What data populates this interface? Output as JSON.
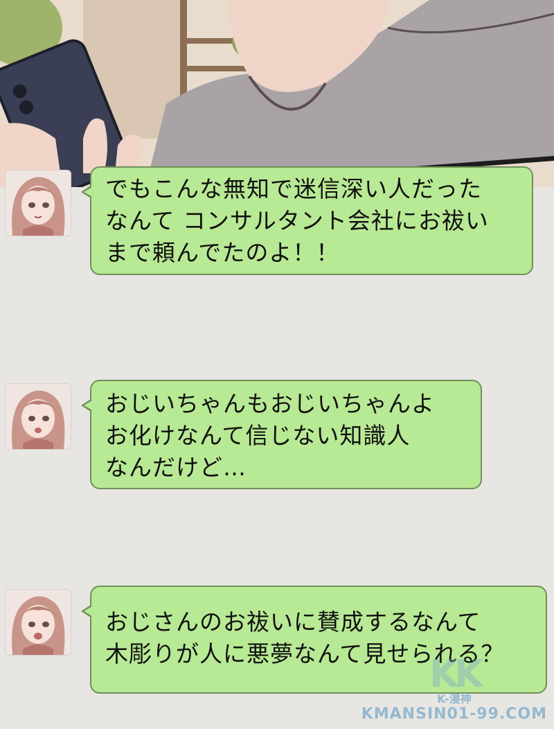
{
  "messages": [
    {
      "sender": "avatar-girl",
      "text": "でもこんな無知で迷信深い人だった\nなんて コンサルタント会社にお祓い\nまで頼んでたのよ！！"
    },
    {
      "sender": "avatar-girl",
      "text": "おじいちゃんもおじいちゃんよ\nお化けなんて信じない知識人\nなんだけど…"
    },
    {
      "sender": "avatar-girl",
      "text": "おじさんのお祓いに賛成するなんて\n木彫りが人に悪夢なんて見せられる？"
    }
  ],
  "watermark": {
    "logo": "KK",
    "brand": "K-漫神",
    "url": "KMANSIN01-99.COM"
  },
  "colors": {
    "bubble": "#b8e994",
    "bubble_border": "#6f8f5b",
    "background": "#e8e6e3"
  }
}
